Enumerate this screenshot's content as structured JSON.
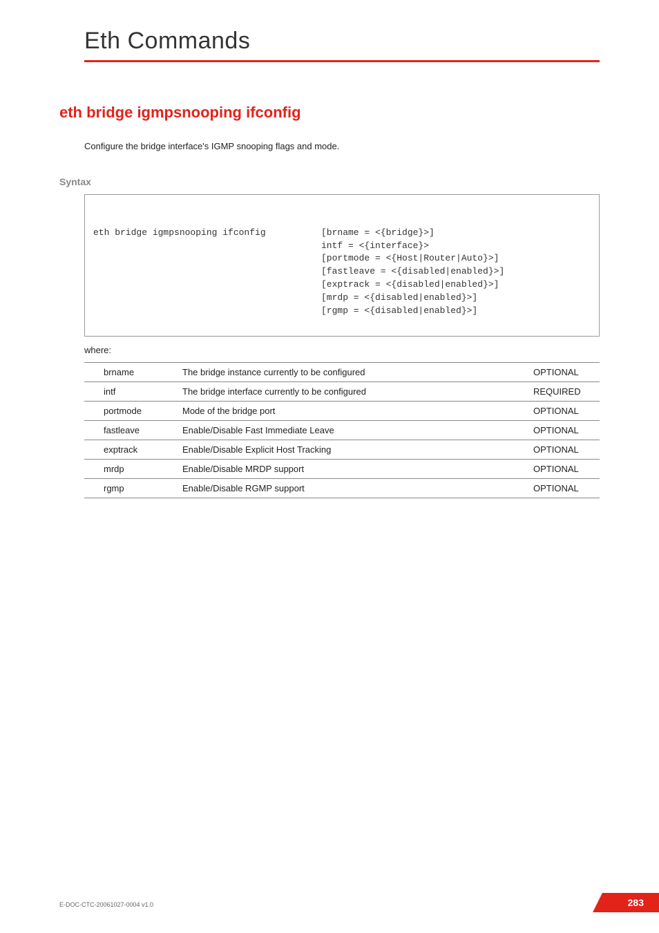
{
  "chapter": {
    "title": "Eth Commands"
  },
  "command": {
    "title": "eth bridge igmpsnooping ifconfig",
    "description": "Configure the bridge interface's IGMP snooping flags and mode."
  },
  "syntax": {
    "label": "Syntax",
    "left": "eth bridge igmpsnooping ifconfig",
    "right": "[brname = <{bridge}>]\nintf = <{interface}>\n[portmode = <{Host|Router|Auto}>]\n[fastleave = <{disabled|enabled}>]\n[exptrack = <{disabled|enabled}>]\n[mrdp = <{disabled|enabled}>]\n[rgmp = <{disabled|enabled}>]"
  },
  "where_label": "where:",
  "params": [
    {
      "name": "brname",
      "desc": "The bridge instance currently to be configured",
      "req": "OPTIONAL"
    },
    {
      "name": "intf",
      "desc": "The bridge interface currently to be configured",
      "req": "REQUIRED"
    },
    {
      "name": "portmode",
      "desc": "Mode of the bridge port",
      "req": "OPTIONAL"
    },
    {
      "name": "fastleave",
      "desc": "Enable/Disable Fast Immediate Leave",
      "req": "OPTIONAL"
    },
    {
      "name": "exptrack",
      "desc": "Enable/Disable Explicit Host Tracking",
      "req": "OPTIONAL"
    },
    {
      "name": "mrdp",
      "desc": "Enable/Disable MRDP support",
      "req": "OPTIONAL"
    },
    {
      "name": "rgmp",
      "desc": "Enable/Disable RGMP support",
      "req": "OPTIONAL"
    }
  ],
  "footer": {
    "docid": "E-DOC-CTC-20061027-0004 v1.0",
    "page": "283"
  }
}
